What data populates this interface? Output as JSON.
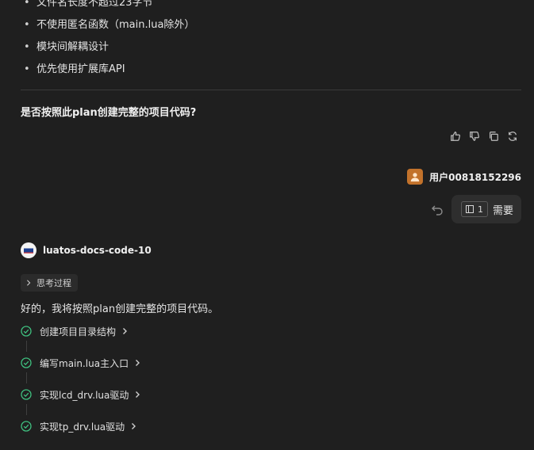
{
  "bullets": [
    "文件名长度不超过23字节",
    "不使用匿名函数（main.lua除外）",
    "模块间解耦设计",
    "优先使用扩展库API"
  ],
  "question": "是否按照此plan创建完整的项目代码?",
  "actions": [
    "thumbs-up-icon",
    "thumbs-down-icon",
    "copy-icon",
    "refresh-icon"
  ],
  "user": {
    "name": "用户00818152296"
  },
  "user_message": {
    "ref_count": "1",
    "text": "需要"
  },
  "bot": {
    "name": "luatos-docs-code-10",
    "think_label": "思考过程"
  },
  "reply": "好的，我将按照plan创建完整的项目代码。",
  "steps": [
    "创建项目目录结构",
    "编写main.lua主入口",
    "实现lcd_drv.lua驱动",
    "实现tp_drv.lua驱动"
  ],
  "colors": {
    "background": "#1f1f1f",
    "check": "#3fbf7f",
    "avatar": "#c2722b"
  }
}
